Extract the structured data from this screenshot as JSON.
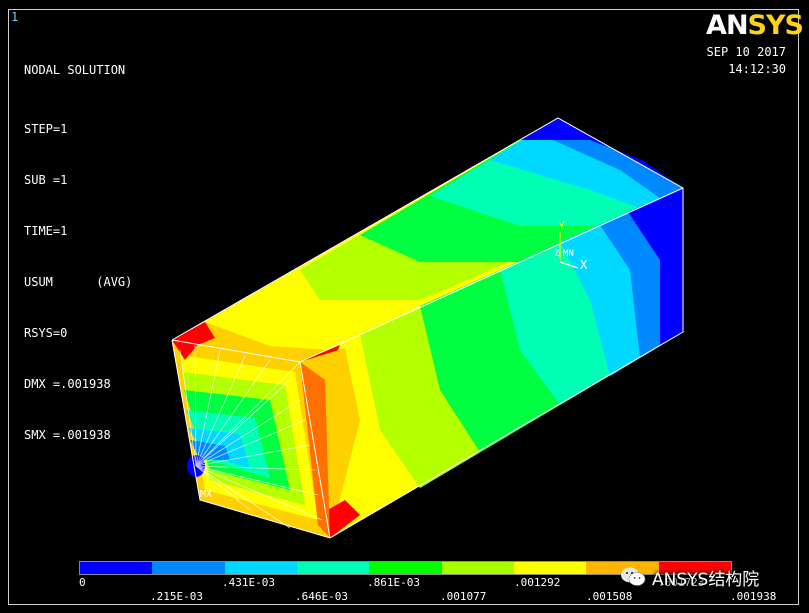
{
  "window_number": "1",
  "info": {
    "title": "NODAL SOLUTION",
    "lines": [
      "STEP=1",
      "SUB =1",
      "TIME=1",
      "USUM      (AVG)",
      "RSYS=0",
      "DMX =.001938",
      "SMX =.001938"
    ]
  },
  "brand": {
    "part1": "AN",
    "part2": "SYS"
  },
  "stamp": {
    "date": "SEP 10 2017",
    "time": "14:12:30"
  },
  "triad": {
    "y": "Y",
    "z": "Z",
    "x": "X",
    "mn": "MN"
  },
  "mx_label": "MX",
  "legend": {
    "colors": [
      "#0000ff",
      "#0088ff",
      "#00d8ff",
      "#00ffb4",
      "#00ff00",
      "#a8ff00",
      "#ffff00",
      "#ffb400",
      "#ff0000"
    ],
    "top_labels": [
      "0",
      ".431E-03",
      ".861E-03",
      ".001292",
      ".001723"
    ],
    "bottom_labels": [
      ".215E-03",
      ".646E-03",
      ".001077",
      ".001508",
      ".001938"
    ]
  },
  "watermark": {
    "text": "ANSYS结构院",
    "icon": "wechat-icon"
  }
}
